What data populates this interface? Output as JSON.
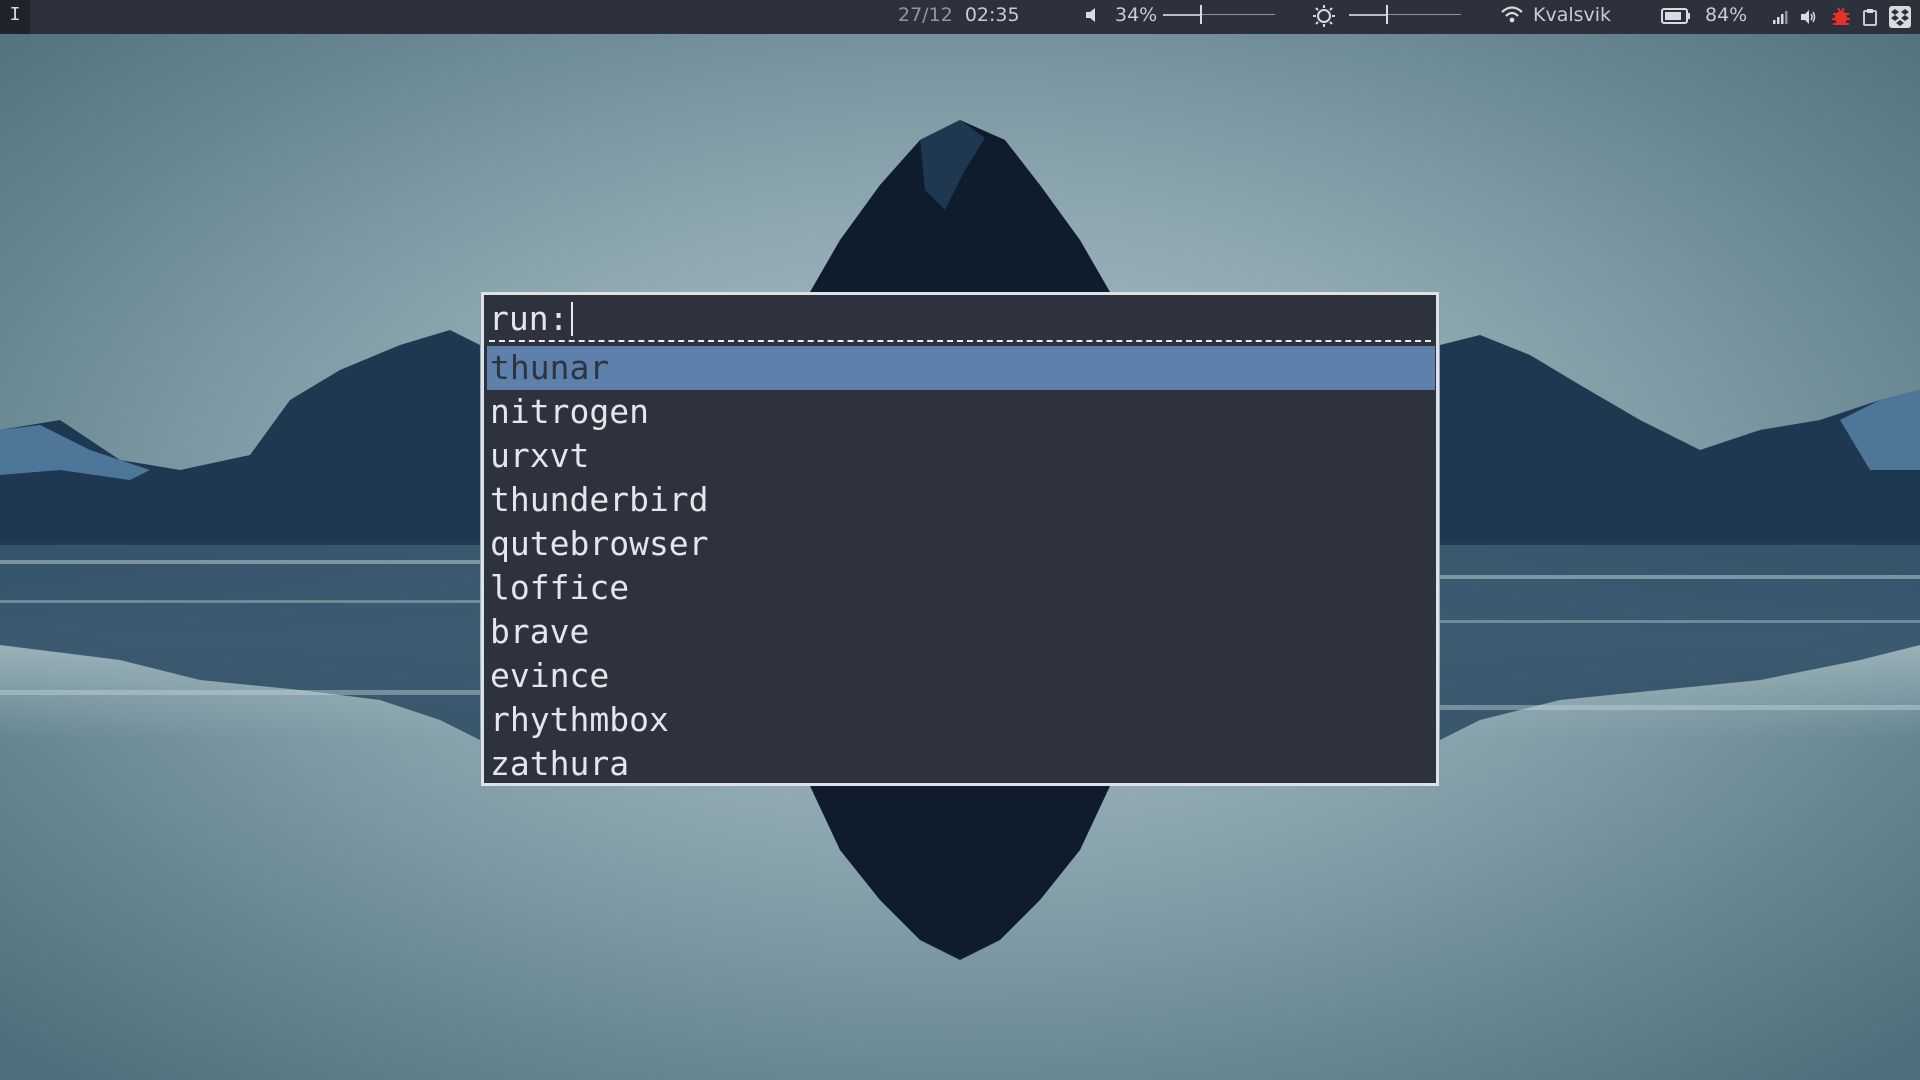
{
  "topbar": {
    "workspace": "I",
    "date": "27/12",
    "time": "02:35",
    "volume_icon": "speaker-icon",
    "volume_percent": "34%",
    "volume_level": 0.34,
    "brightness_icon": "brightness-icon",
    "brightness_level": 0.34,
    "wifi_icon": "wifi-icon",
    "network_name": "Kvalsvik",
    "battery_icon": "battery-icon",
    "battery_percent": "84%",
    "tray": [
      "signal-icon",
      "volume-icon",
      "bug-icon",
      "clipboard-icon",
      "dropbox-icon"
    ],
    "tray_colors": {
      "bug": "#e5322d"
    }
  },
  "launcher": {
    "prompt": "run:",
    "items": [
      "thunar",
      "nitrogen",
      "urxvt",
      "thunderbird",
      "qutebrowser",
      "loffice",
      "brave",
      "evince",
      "rhythmbox",
      "zathura"
    ],
    "selected_index": 0,
    "colors": {
      "background": "#2e323e",
      "selected": "#5e81ac",
      "border": "#dde2e8"
    }
  }
}
